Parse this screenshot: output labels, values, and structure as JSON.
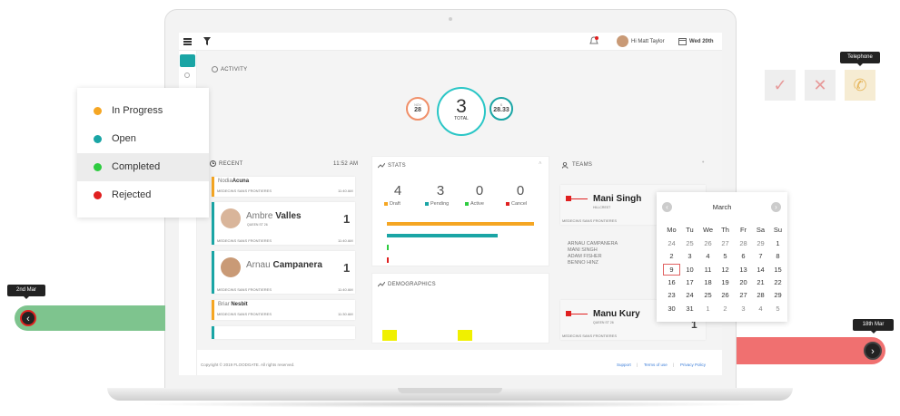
{
  "topbar": {
    "greeting": "Hi Matt Taylor",
    "date": "Wed 20th"
  },
  "activity": {
    "title": "ACTIVITY",
    "left_circle": {
      "label": "NOV",
      "value": "28"
    },
    "center_circle": {
      "value": "3",
      "label": "TOTAL"
    },
    "right_circle": {
      "label": "$",
      "value": "28.33"
    }
  },
  "recent": {
    "title": "RECENT",
    "time": "11:52 AM",
    "cards": [
      {
        "first": "Nodia",
        "last": "Acuna",
        "org": "MEDECINS SANS FRONTIERES",
        "time": "11:40 AM",
        "sub": "",
        "count": ""
      },
      {
        "first": "Ambre",
        "last": "Valles",
        "org": "MEDECINS SANS FRONTIERES",
        "time": "11:40 AM",
        "sub": "QUEEN ST 26",
        "count": "1"
      },
      {
        "first": "Arnau",
        "last": "Campanera",
        "org": "MEDECINS SANS FRONTIERES",
        "time": "11:40 AM",
        "sub": "",
        "count": "1"
      },
      {
        "first": "Briar",
        "last": "Nesbit",
        "org": "MEDECINS SANS FRONTIERES",
        "time": "11:30 AM",
        "sub": "",
        "count": ""
      }
    ]
  },
  "stats": {
    "title": "STATS",
    "items": [
      {
        "value": "4",
        "label": "Draft",
        "color": "#f5a623"
      },
      {
        "value": "3",
        "label": "Pending",
        "color": "#1aa5a5"
      },
      {
        "value": "0",
        "label": "Active",
        "color": "#2ecc40"
      },
      {
        "value": "0",
        "label": "Cancel",
        "color": "#e02020"
      }
    ]
  },
  "demographics": {
    "title": "DEMOGRAPHICS"
  },
  "teams": {
    "title": "TEAMS",
    "team1": {
      "name": "Mani Singh",
      "sub": "HILLCREST",
      "org": "MEDECINS SANS FRONTIERES"
    },
    "members": [
      "ARNAU CAMPANERA",
      "MANI SINGH",
      "ADAM FISHER",
      "BENNO HINZ"
    ],
    "team2": {
      "name": "Manu Kury",
      "sub": "QUEEN ST 26",
      "org": "MEDECINS SANS FRONTIERES",
      "count": "1"
    }
  },
  "footer": {
    "copyright": "Copyright © 2019 FLOODGATE. All rights reserved.",
    "support": "Support",
    "terms": "Terms of use",
    "privacy": "Privacy Policy"
  },
  "legend": {
    "items": [
      {
        "label": "In Progress",
        "color": "#f5a623"
      },
      {
        "label": "Open",
        "color": "#1aa5a5"
      },
      {
        "label": "Completed",
        "color": "#2ecc40"
      },
      {
        "label": "Rejected",
        "color": "#e02020"
      }
    ]
  },
  "calendar": {
    "month": "March",
    "days": [
      "Mo",
      "Tu",
      "We",
      "Th",
      "Fr",
      "Sa",
      "Su"
    ],
    "weeks": [
      [
        "24",
        "25",
        "26",
        "27",
        "28",
        "29",
        "1"
      ],
      [
        "2",
        "3",
        "4",
        "5",
        "6",
        "7",
        "8"
      ],
      [
        "9",
        "10",
        "11",
        "12",
        "13",
        "14",
        "15"
      ],
      [
        "16",
        "17",
        "18",
        "19",
        "20",
        "21",
        "22"
      ],
      [
        "23",
        "24",
        "25",
        "26",
        "27",
        "28",
        "29"
      ],
      [
        "30",
        "31",
        "1",
        "2",
        "3",
        "4",
        "5"
      ]
    ],
    "selected": "9"
  },
  "timeline": {
    "left_date": "2nd Mar",
    "right_date": "18th Mar"
  },
  "telephone_tooltip": "Telephone",
  "colors": {
    "teal": "#1aa5a5",
    "orange": "#f5a623",
    "green": "#7ec48e",
    "red": "#f07070"
  }
}
